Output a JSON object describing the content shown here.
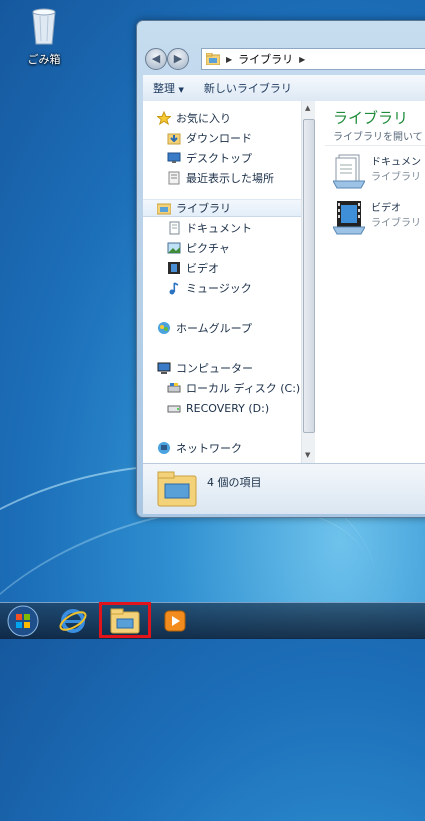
{
  "desktop": {
    "recycle_bin_label": "ごみ箱"
  },
  "explorer": {
    "address": {
      "crumb": "ライブラリ",
      "back_icon": "back-arrow-icon",
      "forward_icon": "forward-arrow-icon"
    },
    "toolbar": {
      "organize_label": "整理",
      "new_library_label": "新しいライブラリ"
    },
    "nav_pane": {
      "favorites": "お気に入り",
      "downloads": "ダウンロード",
      "desktop": "デスクトップ",
      "recent": "最近表示した場所",
      "libraries": "ライブラリ",
      "documents": "ドキュメント",
      "pictures": "ピクチャ",
      "videos": "ビデオ",
      "music": "ミュージック",
      "homegroup": "ホームグループ",
      "computer": "コンピューター",
      "local_disk": "ローカル ディスク (C:)",
      "recovery": "RECOVERY (D:)",
      "network": "ネットワーク"
    },
    "content": {
      "title": "ライブラリ",
      "subtitle": "ライブラリを開いて",
      "items": [
        {
          "name": "ドキュメン",
          "type": "ライブラリ"
        },
        {
          "name": "ビデオ",
          "type": "ライブラリ"
        }
      ]
    },
    "details": {
      "item_count": "4 個の項目"
    }
  },
  "taskbar": {
    "highlight_color": "#e0141a",
    "buttons": [
      "start-orb-icon",
      "internet-explorer-icon",
      "explorer-folder-icon",
      "media-player-icon"
    ]
  }
}
